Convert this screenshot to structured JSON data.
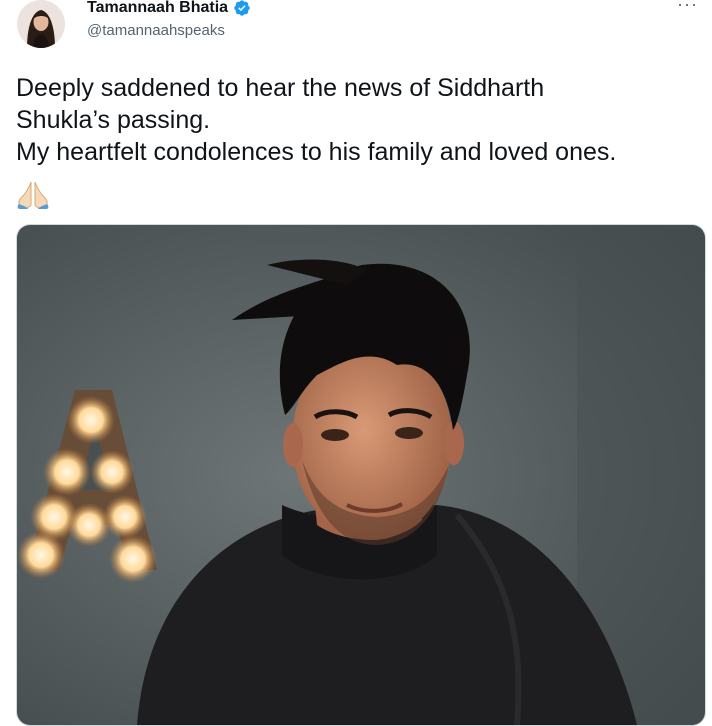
{
  "author": {
    "display_name": "Tamannaah Bhatia",
    "handle": "@tamannaahspeaks",
    "verified_badge_icon": "verified-badge-icon",
    "avatar_icon": "profile-photo"
  },
  "menu": {
    "more_label": "···",
    "icon": "more-options-icon"
  },
  "tweet": {
    "lines": [
      "Deeply saddened to hear the news of Siddharth",
      "Shukla’s passing.",
      "My heartfelt condolences to his family and loved ones."
    ],
    "emoji_icon": "folded-hands-emoji"
  },
  "media": {
    "photo_description_icon": "portrait-photo",
    "marquee_letter": "A"
  },
  "colors": {
    "text": "#0f1419",
    "secondary": "#536471",
    "verified": "#1d9bf0",
    "photo_background": "#545d5f"
  }
}
